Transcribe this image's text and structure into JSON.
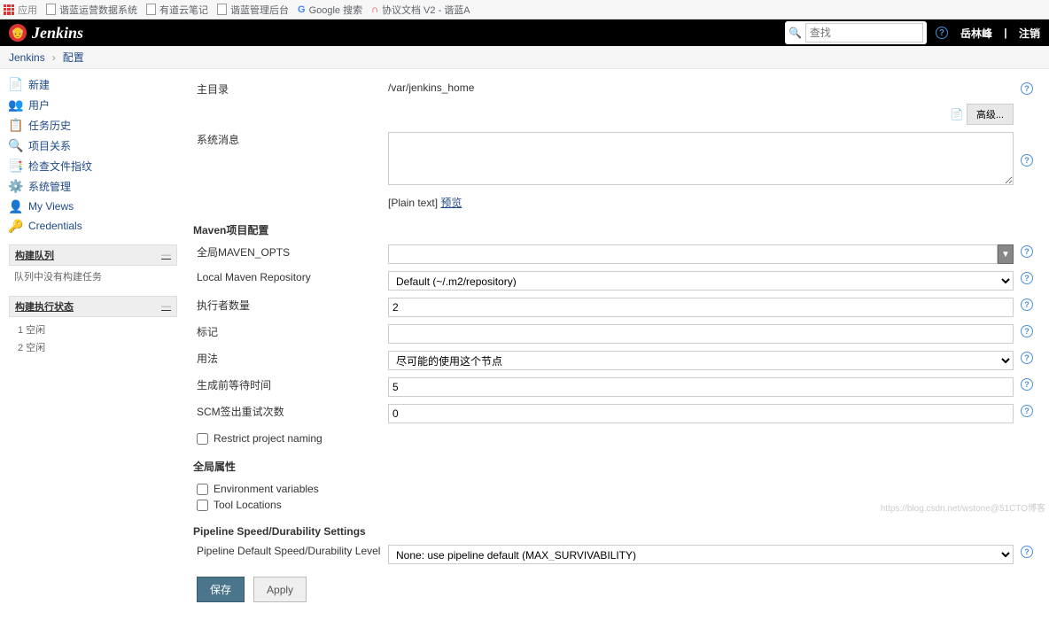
{
  "bookmarks": {
    "apps": "应用",
    "items": [
      "谐蓝运营数据系统",
      "有道云笔记",
      "谐蓝管理后台",
      "Google 搜索",
      "协议文档 V2 - 谐蓝A"
    ]
  },
  "header": {
    "title": "Jenkins",
    "search_placeholder": "查找",
    "user": "岳林峰",
    "logout": "注销"
  },
  "breadcrumb": {
    "root": "Jenkins",
    "page": "配置"
  },
  "sidebar": {
    "menu": [
      {
        "icon": "📄",
        "label": "新建"
      },
      {
        "icon": "👥",
        "label": "用户"
      },
      {
        "icon": "📋",
        "label": "任务历史"
      },
      {
        "icon": "🔍",
        "label": "项目关系"
      },
      {
        "icon": "📑",
        "label": "检查文件指纹"
      },
      {
        "icon": "⚙️",
        "label": "系统管理"
      },
      {
        "icon": "👤",
        "label": "My Views"
      },
      {
        "icon": "🔑",
        "label": "Credentials"
      }
    ],
    "build_queue": {
      "title": "构建队列",
      "empty": "队列中没有构建任务"
    },
    "exec_status": {
      "title": "构建执行状态",
      "executors": [
        "1  空闲",
        "2  空闲"
      ]
    }
  },
  "form": {
    "home_dir": {
      "label": "主目录",
      "value": "/var/jenkins_home"
    },
    "advanced": "高级...",
    "sys_msg": {
      "label": "系统消息",
      "value": ""
    },
    "plain_text": "[Plain text]",
    "preview": "预览",
    "maven_section": "Maven项目配置",
    "maven_opts": {
      "label": "全局MAVEN_OPTS",
      "value": ""
    },
    "local_repo": {
      "label": "Local Maven Repository",
      "value": "Default (~/.m2/repository)"
    },
    "executors": {
      "label": "执行者数量",
      "value": "2"
    },
    "labels": {
      "label": "标记",
      "value": ""
    },
    "usage": {
      "label": "用法",
      "value": "尽可能的使用这个节点"
    },
    "quiet": {
      "label": "生成前等待时间",
      "value": "5"
    },
    "scm_retry": {
      "label": "SCM签出重试次数",
      "value": "0"
    },
    "restrict_naming": "Restrict project naming",
    "global_props": "全局属性",
    "env_vars": "Environment variables",
    "tool_loc": "Tool Locations",
    "pipeline_section": "Pipeline Speed/Durability Settings",
    "pipeline_default": {
      "label": "Pipeline Default Speed/Durability Level",
      "value": "None: use pipeline default (MAX_SURVIVABILITY)"
    },
    "save": "保存",
    "apply": "Apply"
  },
  "watermark": "https://blog.csdn.net/wstone@51CTO博客"
}
